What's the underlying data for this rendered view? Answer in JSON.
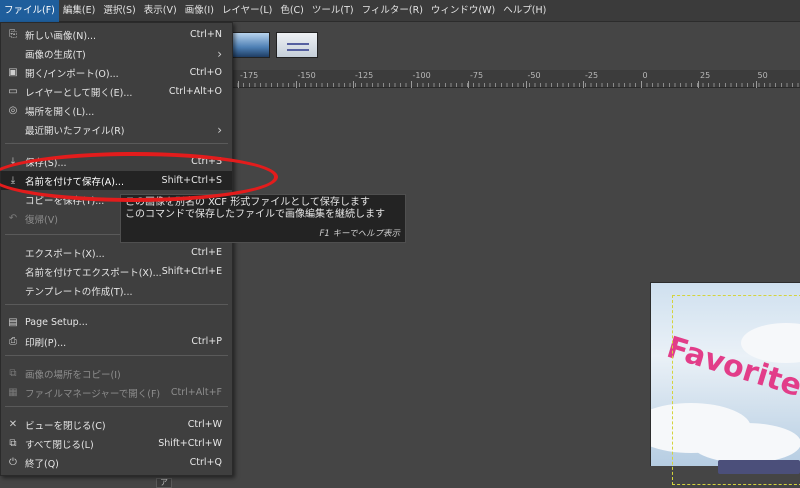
{
  "menubar": {
    "items": [
      {
        "label": "ファイル(F)",
        "active": true
      },
      {
        "label": "編集(E)"
      },
      {
        "label": "選択(S)"
      },
      {
        "label": "表示(V)"
      },
      {
        "label": "画像(I)"
      },
      {
        "label": "レイヤー(L)"
      },
      {
        "label": "色(C)"
      },
      {
        "label": "ツール(T)"
      },
      {
        "label": "フィルター(R)"
      },
      {
        "label": "ウィンドウ(W)"
      },
      {
        "label": "ヘルプ(H)"
      }
    ]
  },
  "file_menu": {
    "items": [
      {
        "label": "新しい画像(N)...",
        "shortcut": "Ctrl+N",
        "icon": "new-image-icon",
        "glyph": "⎘",
        "disabled": false
      },
      {
        "label": "画像の生成(T)",
        "submenu": true,
        "disabled": false
      },
      {
        "label": "開く/インポート(O)...",
        "shortcut": "Ctrl+O",
        "icon": "open-icon",
        "glyph": "▣",
        "disabled": false
      },
      {
        "label": "レイヤーとして開く(E)...",
        "shortcut": "Ctrl+Alt+O",
        "icon": "open-as-layer-icon",
        "glyph": "▭",
        "disabled": false
      },
      {
        "label": "場所を開く(L)...",
        "icon": "open-location-icon",
        "glyph": "◎",
        "disabled": false
      },
      {
        "label": "最近開いたファイル(R)",
        "submenu": true,
        "disabled": false
      },
      {
        "label": "保存(S)...",
        "shortcut": "Ctrl+S",
        "icon": "save-icon",
        "glyph": "⤓",
        "disabled": false
      },
      {
        "label": "名前を付けて保存(A)...",
        "shortcut": "Shift+Ctrl+S",
        "icon": "save-as-icon",
        "glyph": "⤓",
        "disabled": false,
        "highlight": true
      },
      {
        "label": "コピーを保存(Y)...",
        "icon": "save-copy-icon",
        "glyph": "",
        "disabled": false
      },
      {
        "label": "復帰(V)",
        "icon": "revert-icon",
        "glyph": "↶",
        "disabled": true
      },
      {
        "label": "エクスポート(X)...",
        "shortcut": "Ctrl+E",
        "disabled": false
      },
      {
        "label": "名前を付けてエクスポート(X)...",
        "shortcut": "Shift+Ctrl+E",
        "disabled": false
      },
      {
        "label": "テンプレートの作成(T)...",
        "disabled": false
      },
      {
        "label": "Page Setup...",
        "icon": "page-setup-icon",
        "glyph": "▤",
        "disabled": false
      },
      {
        "label": "印刷(P)...",
        "shortcut": "Ctrl+P",
        "icon": "print-icon",
        "glyph": "⎙",
        "disabled": false
      },
      {
        "label": "画像の場所をコピー(I)",
        "icon": "copy-location-icon",
        "glyph": "⧉",
        "disabled": true
      },
      {
        "label": "ファイルマネージャーで開く(F)",
        "shortcut": "Ctrl+Alt+F",
        "icon": "file-manager-icon",
        "glyph": "▦",
        "disabled": true
      },
      {
        "label": "ビューを閉じる(C)",
        "shortcut": "Ctrl+W",
        "icon": "close-view-icon",
        "glyph": "✕",
        "disabled": false
      },
      {
        "label": "すべて閉じる(L)",
        "shortcut": "Shift+Ctrl+W",
        "icon": "close-all-icon",
        "glyph": "⧉",
        "disabled": false
      },
      {
        "label": "終了(Q)",
        "shortcut": "Ctrl+Q",
        "icon": "quit-icon",
        "glyph": "⏻",
        "disabled": false
      }
    ]
  },
  "tooltip": {
    "line1": "この画像を別名の XCF 形式ファイルとして保存します",
    "line2": "このコマンドで保存したファイルで画像編集を継続します",
    "help": "F1 キーでヘルプ表示"
  },
  "ruler": {
    "labels": [
      "-175",
      "-150",
      "-125",
      "-100",
      "-75",
      "-50",
      "-25",
      "0",
      "25",
      "50"
    ]
  },
  "canvas": {
    "text": "Favorite"
  },
  "corner_icon": "ア",
  "colors": {
    "annotation": "#e31c1c",
    "highlight": "#232323",
    "overlay_text": "#e23d89",
    "menubar_active": "#1f5e9c"
  }
}
